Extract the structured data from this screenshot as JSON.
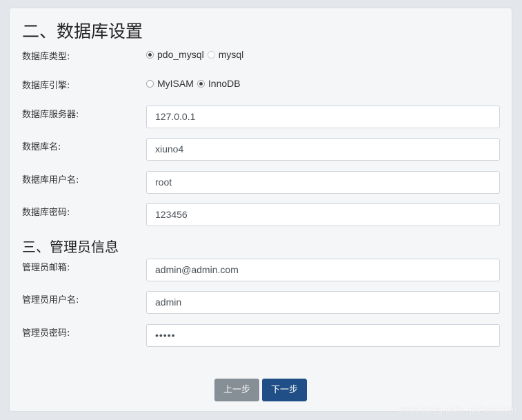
{
  "db_section": {
    "title": "二、数据库设置",
    "type": {
      "label": "数据库类型:",
      "options": [
        "pdo_mysql",
        "mysql"
      ],
      "selected": "pdo_mysql"
    },
    "engine": {
      "label": "数据库引擎:",
      "options": [
        "MyISAM",
        "InnoDB"
      ],
      "selected": "InnoDB"
    },
    "host": {
      "label": "数据库服务器:",
      "value": "127.0.0.1"
    },
    "name": {
      "label": "数据库名:",
      "value": "xiuno4"
    },
    "user": {
      "label": "数据库用户名:",
      "value": "root"
    },
    "password": {
      "label": "数据库密码:",
      "value": "123456"
    }
  },
  "admin_section": {
    "title": "三、管理员信息",
    "email": {
      "label": "管理员邮箱:",
      "value": "admin@admin.com"
    },
    "username": {
      "label": "管理员用户名:",
      "value": "admin"
    },
    "password": {
      "label": "管理员密码:",
      "value": "•••••"
    }
  },
  "buttons": {
    "prev_label": "上一步",
    "next_label": "下一步"
  },
  "watermark": "https://blog.csdn.net/xwebsite",
  "colors": {
    "page_bg": "#e3e6ea",
    "card_bg": "#f5f6f8",
    "prev_button": "#868e96",
    "next_button": "#1f4f86"
  }
}
